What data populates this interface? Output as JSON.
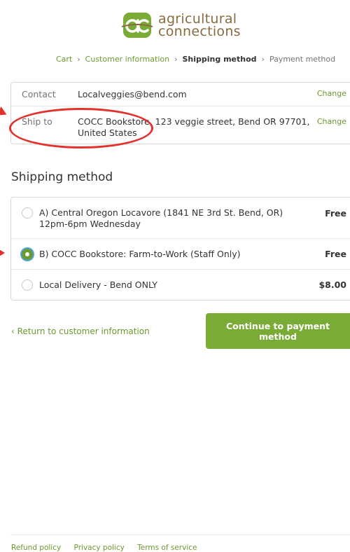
{
  "brand": {
    "line1": "agricultural",
    "line2": "connections",
    "colors": {
      "mark": "#7aab37",
      "text": "#8a6a3e"
    }
  },
  "breadcrumb": {
    "items": [
      "Cart",
      "Customer information",
      "Shipping method",
      "Payment method"
    ],
    "current_index": 2
  },
  "review": {
    "contact": {
      "label": "Contact",
      "value": "Localveggies@bend.com",
      "action": "Change"
    },
    "ship_to": {
      "label": "Ship to",
      "value": "COCC Bookstore, 123 veggie street, Bend OR 97701, United States",
      "action": "Change"
    }
  },
  "shipping": {
    "title": "Shipping method",
    "selected_index": 1,
    "options": [
      {
        "label": "A) Central Oregon Locavore (1841 NE 3rd St. Bend, OR) 12pm-6pm Wednesday",
        "price": "Free"
      },
      {
        "label": "B) COCC Bookstore: Farm-to-Work (Staff Only)",
        "price": "Free"
      },
      {
        "label": "Local Delivery - Bend ONLY",
        "price": "$8.00"
      }
    ]
  },
  "actions": {
    "return_label": "Return to customer information",
    "continue_label": "Continue to payment method"
  },
  "footer": {
    "links": [
      "Refund policy",
      "Privacy policy",
      "Terms of service"
    ]
  },
  "colors": {
    "accent": "#7aab37",
    "link": "#6b9a2e",
    "annotation": "#e3312d",
    "focus_ring": "#4fa3e0"
  }
}
